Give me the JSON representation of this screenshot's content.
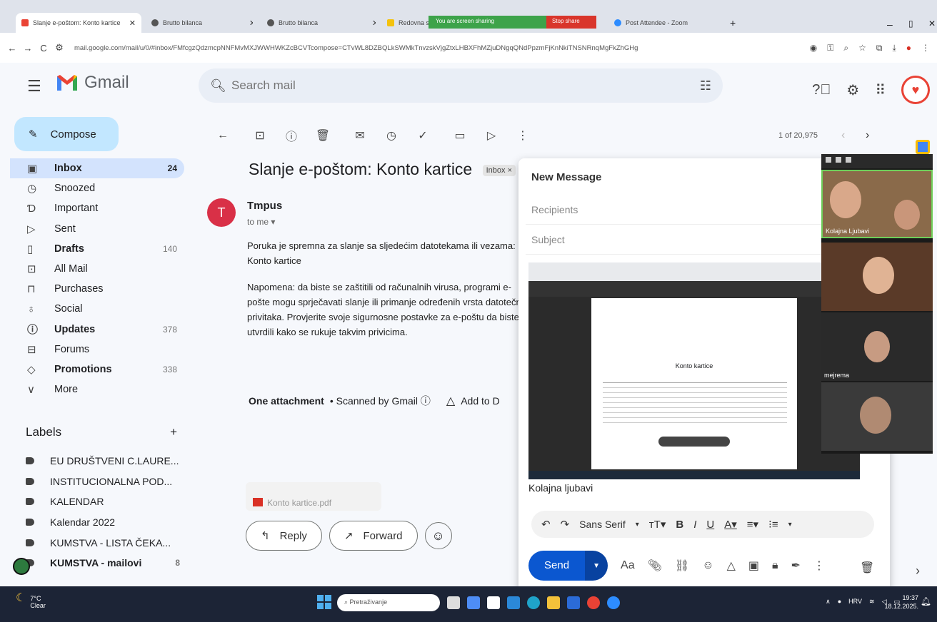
{
  "browser": {
    "tabs": [
      {
        "label": "Slanje e-poštom: Konto kartice",
        "active": true
      },
      {
        "label": "Brutto bilanca",
        "active": false
      },
      {
        "label": "Brutto bilanca",
        "active": false
      },
      {
        "label": "Redovna sk...",
        "active": false
      },
      {
        "label": "Post Attendee - Zoom",
        "active": false
      }
    ],
    "screen_share_text": "You are screen sharing",
    "stop_share_label": "Stop share",
    "url": "mail.google.com/mail/u/0/#inbox/FMfcgzQdzmcpNNFMvMXJWWHWKZcBCVTcompose=CTvWL8DZBQLkSWMkTnvzskVjgZtxLHBXFhMZjuDNgqQNdPpzmFjKnNkiTNSNRnqMgFkZhGHg"
  },
  "gmail": {
    "brand": "Gmail",
    "search_placeholder": "Search mail",
    "compose_label": "Compose",
    "nav": [
      {
        "label": "Inbox",
        "count": "24",
        "icon": "inbox-icon",
        "glyph": "▣",
        "bold": true,
        "active": true
      },
      {
        "label": "Snoozed",
        "count": "",
        "icon": "clock-icon",
        "glyph": "◷",
        "bold": false
      },
      {
        "label": "Important",
        "count": "",
        "icon": "important-icon",
        "glyph": "Ɗ",
        "bold": false
      },
      {
        "label": "Sent",
        "count": "",
        "icon": "send-icon",
        "glyph": "▷",
        "bold": false
      },
      {
        "label": "Drafts",
        "count": "140",
        "icon": "draft-icon",
        "glyph": "▯",
        "bold": true
      },
      {
        "label": "All Mail",
        "count": "",
        "icon": "all-mail-icon",
        "glyph": "⊡",
        "bold": false
      },
      {
        "label": "Purchases",
        "count": "",
        "icon": "bag-icon",
        "glyph": "⊓",
        "bold": false
      },
      {
        "label": "Social",
        "count": "",
        "icon": "people-icon",
        "glyph": "♁",
        "bold": false
      },
      {
        "label": "Updates",
        "count": "378",
        "icon": "info-icon",
        "glyph": "ⓘ",
        "bold": true
      },
      {
        "label": "Forums",
        "count": "",
        "icon": "forum-icon",
        "glyph": "⊟",
        "bold": false
      },
      {
        "label": "Promotions",
        "count": "338",
        "icon": "tag-icon",
        "glyph": "◇",
        "bold": true
      },
      {
        "label": "More",
        "count": "",
        "icon": "chevron-down-icon",
        "glyph": "∨",
        "bold": false
      }
    ],
    "labels_title": "Labels",
    "labels": [
      {
        "label": "EU DRUŠTVENI C.LAURE...",
        "count": "",
        "bold": false
      },
      {
        "label": "INSTITUCIONALNA POD...",
        "count": "",
        "bold": false
      },
      {
        "label": "KALENDAR",
        "count": "",
        "bold": false
      },
      {
        "label": "Kalendar 2022",
        "count": "",
        "bold": false
      },
      {
        "label": "KUMSTVA - LISTA ČEKA...",
        "count": "",
        "bold": false
      },
      {
        "label": "KUMSTVA - mailovi",
        "count": "8",
        "bold": true
      }
    ],
    "pager": "1 of 20,975",
    "message": {
      "subject": "Slanje e-poštom: Konto kartice",
      "inbox_badge": "Inbox ×",
      "sender_initial": "T",
      "sender": "Tmpus",
      "to_me": "to me ▾",
      "paragraph1": "Poruka je spremna za slanje sa sljedećim datotekama ili vezama:\nKonto kartice",
      "paragraph2": "Napomena: da biste se zaštitili od računalnih virusa, programi e-pošte mogu sprječavati slanje ili primanje određenih vrsta datotečnih privitaka. Provjerite svoje sigurnosne postavke za e-poštu da biste utvrdili kako se rukuje takvim privicima.",
      "attachment_heading": "One attachment",
      "scanned": "• Scanned by Gmail ⓘ",
      "add_to_drive": "Add to D",
      "attachment_name": "Konto kartice.pdf",
      "reply_label": "Reply",
      "forward_label": "Forward"
    }
  },
  "composer": {
    "title": "New Message",
    "recipients_placeholder": "Recipients",
    "subject_placeholder": "Subject",
    "doc_title": "Konto kartice",
    "signature": "Kolajna ljubavi",
    "font": "Sans Serif",
    "send_label": "Send",
    "format_label": "Aa"
  },
  "zoom": {
    "participants": [
      {
        "name": "Kolajna Ljubavi"
      },
      {
        "name": ""
      },
      {
        "name": "mejrema"
      },
      {
        "name": ""
      }
    ]
  },
  "taskbar": {
    "temperature": "7°C",
    "weather": "Clear",
    "search_placeholder": "Pretraživanje",
    "language": "HRV",
    "time": "19:37",
    "date": "18.12.2025."
  }
}
